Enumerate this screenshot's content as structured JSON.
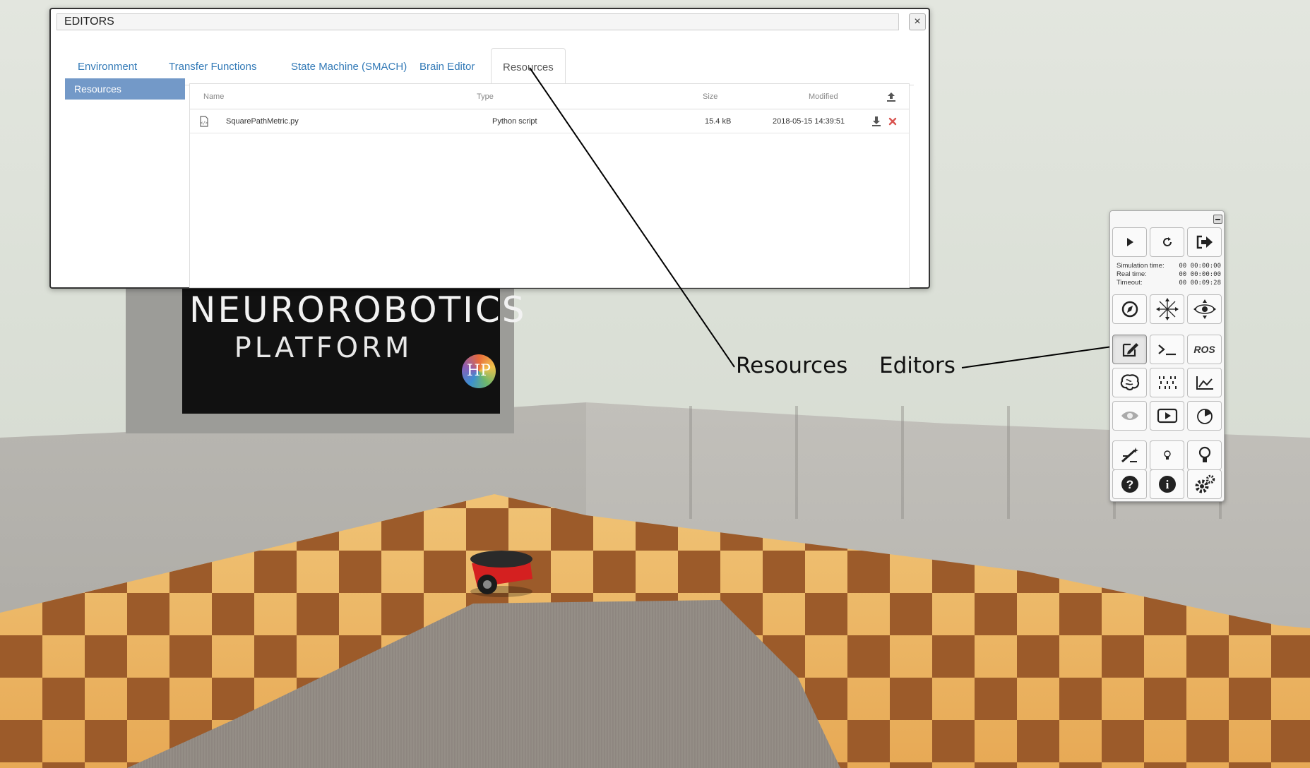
{
  "editors": {
    "title": "EDITORS",
    "close_label": "×",
    "tabs": [
      {
        "label": "Environment"
      },
      {
        "label": "Transfer Functions"
      },
      {
        "label": "State Machine (SMACH)"
      },
      {
        "label": "Brain Editor"
      },
      {
        "label": "Resources",
        "active": true
      }
    ],
    "sidebar_label": "Resources",
    "columns": {
      "name": "Name",
      "type": "Type",
      "size": "Size",
      "modified": "Modified"
    },
    "files": [
      {
        "name": "SquarePathMetric.py",
        "type": "Python script",
        "size": "15.4 kB",
        "modified": "2018-05-15 14:39:51"
      }
    ],
    "icons": {
      "upload": "upload-icon",
      "file": "file-code-icon",
      "download": "download-icon",
      "delete": "delete-icon"
    }
  },
  "annotations": {
    "resources": "Resources",
    "editors": "Editors"
  },
  "control_panel": {
    "simulation_time_label": "Simulation time:",
    "simulation_time": "00 00:00:00",
    "real_time_label": "Real time:",
    "real_time": "00 00:00:00",
    "timeout_label": "Timeout:",
    "timeout": "00 00:09:28",
    "ros_label": "ROS",
    "icons": [
      "play-icon",
      "reset-icon",
      "exit-icon",
      "navigation-icon",
      "move-icon",
      "orbit-icon",
      "edit-icon",
      "terminal-icon",
      "ros-icon",
      "brain-icon",
      "spike-train-icon",
      "plot-icon",
      "eye-icon",
      "video-icon",
      "timer-icon",
      "wand-icon",
      "light-small-icon",
      "light-large-icon",
      "help-icon",
      "info-icon",
      "settings-icon"
    ]
  },
  "scene": {
    "sign_line1": "NEUROROBOTICS",
    "sign_line2": "PLATFORM",
    "sign_logo": "HP"
  },
  "colors": {
    "accent_blue": "#337ab7",
    "sidebar_active": "#7399c8",
    "delete_red": "#d9534f"
  }
}
